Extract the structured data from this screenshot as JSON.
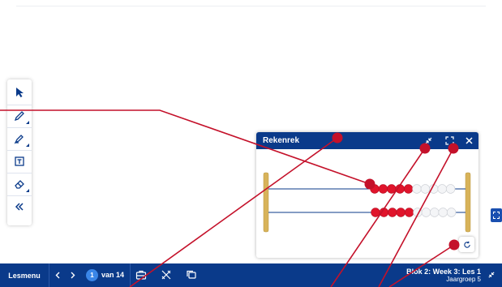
{
  "toolbar": {
    "tools": [
      {
        "name": "select-tool",
        "icon": "cursor-arrow-icon"
      },
      {
        "name": "pen-tool",
        "icon": "pencil-icon"
      },
      {
        "name": "highlighter-tool",
        "icon": "highlighter-icon"
      },
      {
        "name": "text-tool",
        "icon": "text-box-icon"
      },
      {
        "name": "eraser-tool",
        "icon": "eraser-icon"
      },
      {
        "name": "collapse-toolbar",
        "icon": "double-chevron-left-icon"
      }
    ]
  },
  "widget": {
    "title": "Rekenrek",
    "buttons": [
      "minimize-icon",
      "fullscreen-icon",
      "close-icon",
      "reset-icon"
    ],
    "rows": [
      {
        "red": 5,
        "white": 5
      },
      {
        "red": 5,
        "white": 5
      }
    ]
  },
  "bottom_bar": {
    "menu_label": "Lesmenu",
    "current_page": "1",
    "page_of": "van 14",
    "lesson_title": "Blok 2: Week 3: Les 1",
    "lesson_sub": "Jaargroep 5"
  },
  "colors": {
    "primary": "#0a3a8a",
    "bead_red": "#e0142b",
    "annotation": "#c4112a",
    "frame_gold": "#d8b35a",
    "page_circle": "#3a86e8"
  }
}
